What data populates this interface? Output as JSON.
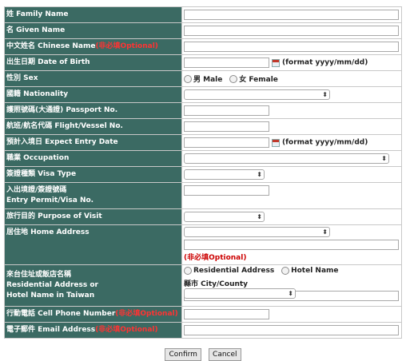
{
  "form": {
    "family_name_label": "姓 Family Name",
    "given_name_label": "名 Given Name",
    "chinese_name_label": "中文姓名 Chinese Name",
    "chinese_name_optional": "(非必填Optional)",
    "dob_label": "出生日期 Date of Birth",
    "dob_format": "(format yyyy/mm/dd)",
    "sex_label": "性別 Sex",
    "sex_male": "男 Male",
    "sex_female": "女 Female",
    "nationality_label": "國籍 Nationality",
    "passport_label": "護照號碼(大通證) Passport No.",
    "flight_label": "航班/航名代碼 Flight/Vessel No.",
    "entry_date_label": "預計入境日 Expect Entry Date",
    "entry_date_format": "(format yyyy/mm/dd)",
    "occupation_label": "職業 Occupation",
    "visa_type_label": "簽證種類 Visa Type",
    "entry_permit_label_1": "入出境證/簽證號碼",
    "entry_permit_label_2": "Entry Permit/Visa No.",
    "purpose_label": "旅行目的 Purpose of Visit",
    "home_address_label": "居住地 Home Address",
    "home_address_optional": "(非必填Optional)",
    "residence_label_1": "來台住址或飯店名稱",
    "residence_label_2": "Residential Address or",
    "residence_label_3": "Hotel Name in Taiwan",
    "residence_option_address": "Residential Address",
    "residence_option_hotel": "Hotel Name",
    "city_label": "縣市 City/County",
    "phone_label": "行動電話 Cell Phone Number",
    "phone_optional": "(非必填Optional)",
    "email_label": "電子郵件 Email Address",
    "email_optional": "(非必填Optional)"
  },
  "buttons": {
    "confirm": "Confirm",
    "cancel": "Cancel"
  },
  "colors": {
    "label_background": "#3b6a63",
    "optional_text": "#ff3333"
  }
}
